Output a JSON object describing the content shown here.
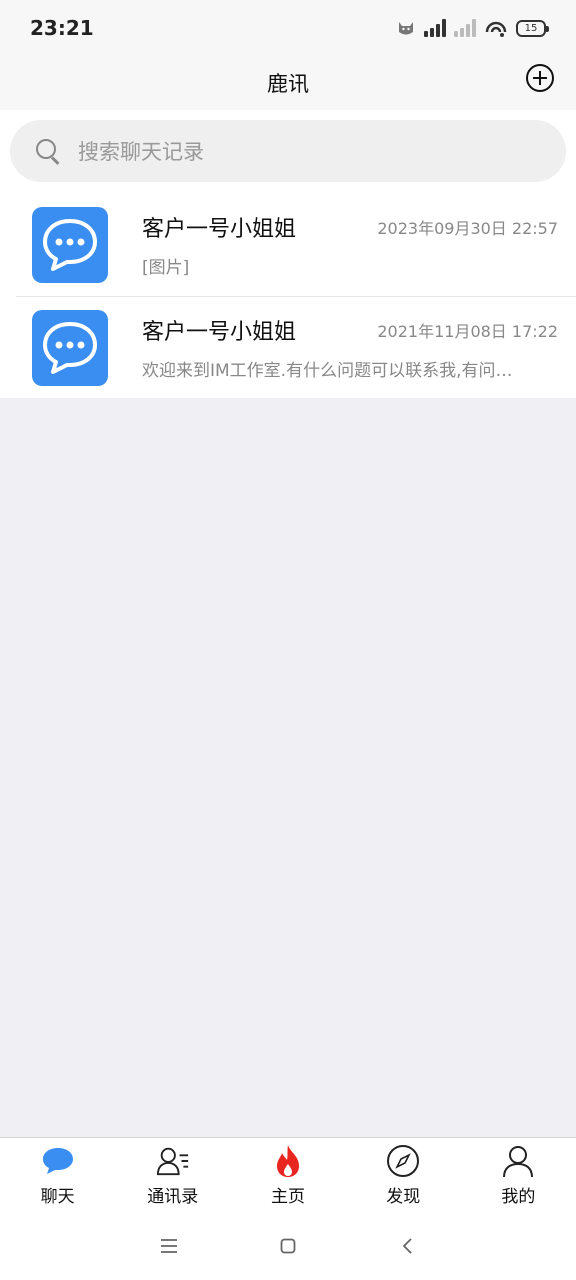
{
  "status_bar": {
    "time": "23:21",
    "battery": "15"
  },
  "header": {
    "title": "鹿讯",
    "add_icon": "plus-circle-icon"
  },
  "search": {
    "placeholder": "搜索聊天记录"
  },
  "chats": [
    {
      "name": "客户一号小姐姐",
      "time": "2023年09月30日 22:57",
      "preview": "[图片]",
      "avatar_icon": "chat-bubble-icon"
    },
    {
      "name": "客户一号小姐姐",
      "time": "2021年11月08日 17:22",
      "preview": "欢迎来到IM工作室.有什么问题可以联系我,有问题可以联系我",
      "avatar_icon": "chat-bubble-icon"
    }
  ],
  "tabs": [
    {
      "label": "聊天",
      "icon": "chat-icon",
      "active": true
    },
    {
      "label": "通讯录",
      "icon": "contacts-icon"
    },
    {
      "label": "主页",
      "icon": "flame-icon"
    },
    {
      "label": "发现",
      "icon": "compass-icon"
    },
    {
      "label": "我的",
      "icon": "person-icon"
    }
  ],
  "colors": {
    "accent": "#3a8ef2",
    "flame": "#e8251f",
    "background": "#efeff4"
  }
}
